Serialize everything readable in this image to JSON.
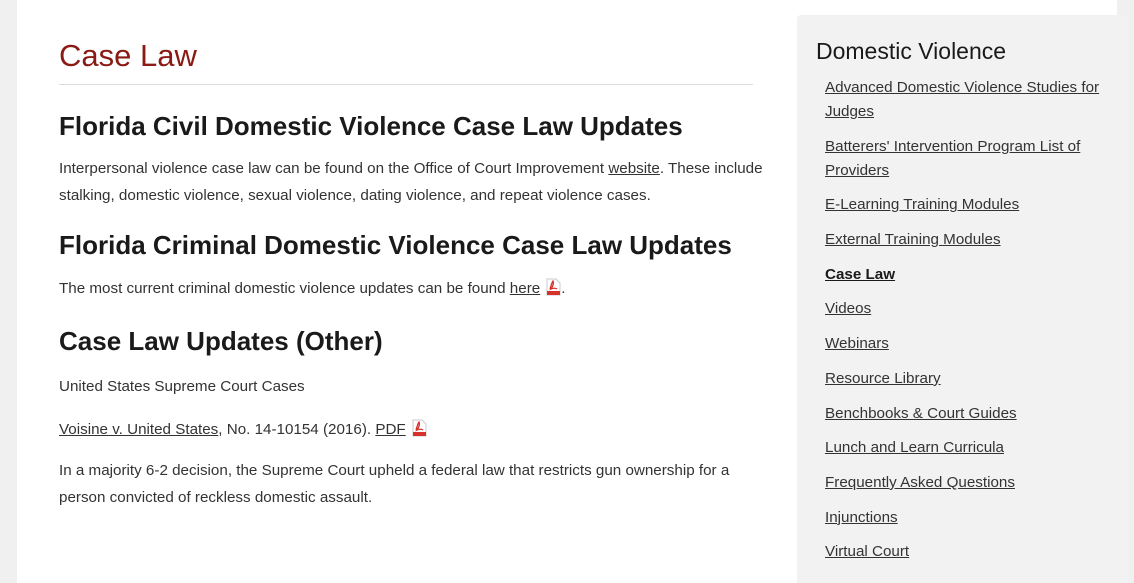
{
  "main": {
    "page_title": "Case Law",
    "sections": {
      "civil": {
        "heading": "Florida Civil Domestic Violence Case Law Updates",
        "text_before": "Interpersonal violence case law can be found on the Office of Court Improvement ",
        "link": "website",
        "text_after": ". These include stalking, domestic violence, sexual violence, dating violence, and repeat violence cases."
      },
      "criminal": {
        "heading": "Florida Criminal Domestic Violence Case Law Updates",
        "text_before": "The most current criminal domestic violence updates can be found ",
        "link": "here",
        "text_after": "."
      },
      "other": {
        "heading": "Case Law Updates (Other)",
        "subheading": "United States Supreme Court Cases",
        "case_link": "Voisine v. United States",
        "case_text": ", No. 14-10154 (2016). ",
        "case_pdf": "PDF",
        "summary": "In a majority 6-2 decision, the Supreme Court upheld a federal law that restricts gun ownership for a person convicted of reckless domestic assault."
      }
    }
  },
  "sidebar": {
    "title": "Domestic Violence",
    "items": [
      {
        "label": "Advanced Domestic Violence Studies for Judges",
        "active": false
      },
      {
        "label": "Batterers' Intervention Program List of Providers",
        "active": false
      },
      {
        "label": "E-Learning Training Modules",
        "active": false
      },
      {
        "label": "External Training Modules",
        "active": false
      },
      {
        "label": "Case Law",
        "active": true
      },
      {
        "label": "Videos",
        "active": false
      },
      {
        "label": "Webinars",
        "active": false
      },
      {
        "label": "Resource Library",
        "active": false
      },
      {
        "label": "Benchbooks & Court Guides",
        "active": false
      },
      {
        "label": "Lunch and Learn Curricula",
        "active": false
      },
      {
        "label": "Frequently Asked Questions",
        "active": false
      },
      {
        "label": "Injunctions",
        "active": false
      },
      {
        "label": "Virtual Court",
        "active": false
      }
    ]
  },
  "icons": {
    "pdf": "pdf-icon"
  },
  "colors": {
    "title": "#8a1a13",
    "pdf_red": "#d6322b"
  }
}
